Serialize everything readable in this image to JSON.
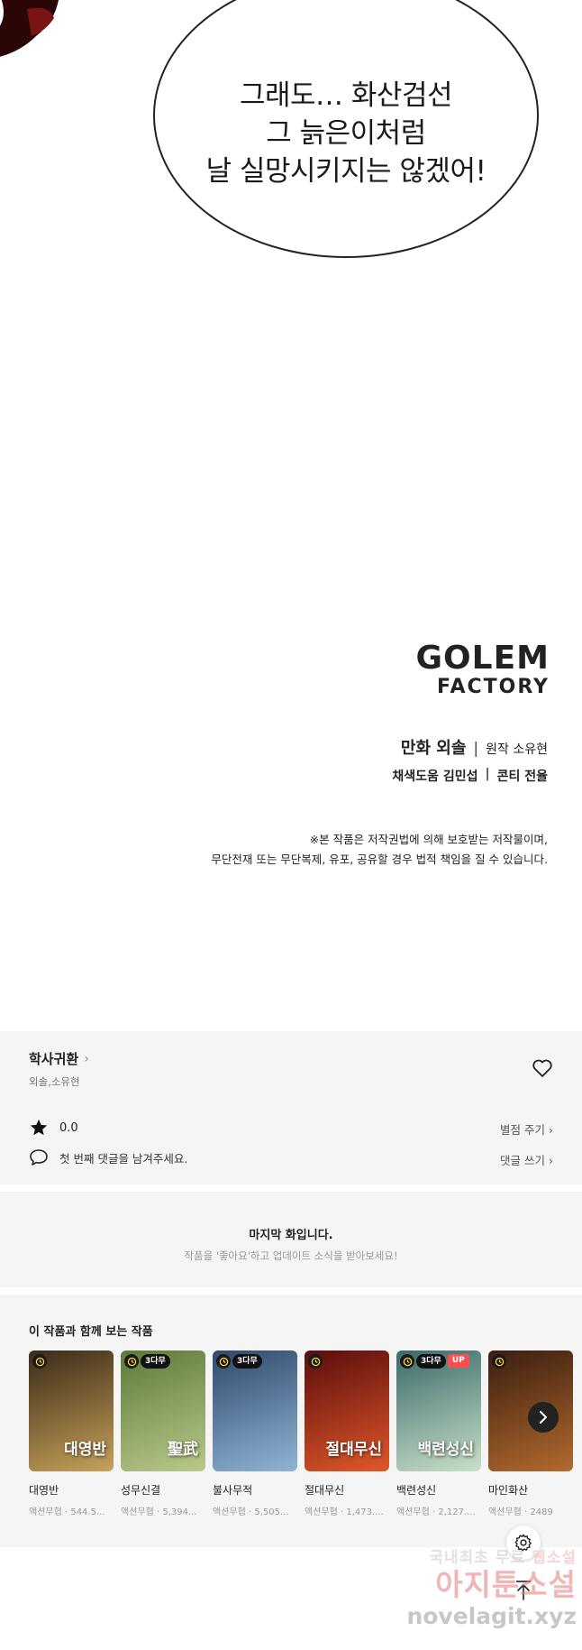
{
  "comic": {
    "bubble_lines": [
      "그래도… 화산검선",
      "그 늙은이처럼",
      "날 실망시키지는 않겠어!"
    ],
    "logo": {
      "line1": "GOLEM",
      "line2": "FACTORY"
    },
    "credits": {
      "line1_main": "만화 외솔",
      "line1_sep": "|",
      "line1_sub": "원작 소유현",
      "line2_a": "채색도움 김민섭",
      "line2_sep": "|",
      "line2_b": "콘티 전율"
    },
    "notice": [
      "※본 작품은 저작권법에 의해 보호받는 저작물이며,",
      "무단전재 또는 무단복제, 유포, 공유할 경우 법적 책임을 질 수 있습니다."
    ]
  },
  "info": {
    "title": "학사귀환",
    "authors": "외솔,소유현",
    "rating": "0.0",
    "rate_link": "별점 주기",
    "comment_placeholder": "첫 번째 댓글을 남겨주세요.",
    "comment_link": "댓글 쓰기"
  },
  "last_episode": {
    "title": "마지막 화입니다.",
    "subtitle": "작품을 '좋아요'하고 업데이트 소식을 받아보세요!"
  },
  "recommendations": {
    "title": "이 작품과 함께 보는 작품",
    "items": [
      {
        "name": "대영반",
        "meta": "액션무협 · 544.5...",
        "badges": [
          "clock"
        ],
        "cover_text": "대영반",
        "colors": [
          "#3a2a18",
          "#c8a25a"
        ]
      },
      {
        "name": "성무신결",
        "meta": "액션무협 · 5,394...",
        "badges": [
          "clock",
          "3다무"
        ],
        "cover_text": "聖武",
        "colors": [
          "#5c7a3a",
          "#b9c98a"
        ]
      },
      {
        "name": "불사무적",
        "meta": "액션무협 · 5,505...",
        "badges": [
          "clock",
          "3다무"
        ],
        "cover_text": "",
        "colors": [
          "#2f4a6a",
          "#8fb4d6"
        ]
      },
      {
        "name": "절대무신",
        "meta": "액션무협 · 1,473....",
        "badges": [
          "clock"
        ],
        "cover_text": "절대무신",
        "colors": [
          "#5a0d0d",
          "#e0582a"
        ]
      },
      {
        "name": "백련성신",
        "meta": "액션무협 · 2,127....",
        "badges": [
          "clock",
          "3다무",
          "UP"
        ],
        "cover_text": "백련성신",
        "colors": [
          "#3a6a6a",
          "#c9e0c8"
        ]
      },
      {
        "name": "마인화산",
        "meta": "액션무협 · 2489",
        "badges": [
          "clock"
        ],
        "cover_text": "",
        "colors": [
          "#3a1e10",
          "#b36a2e"
        ]
      }
    ]
  },
  "watermark": {
    "line1_a": "국내최초 무료",
    "line1_b": "웹소설",
    "line2": "아지툰소설",
    "line3": "novelagit.xyz"
  }
}
